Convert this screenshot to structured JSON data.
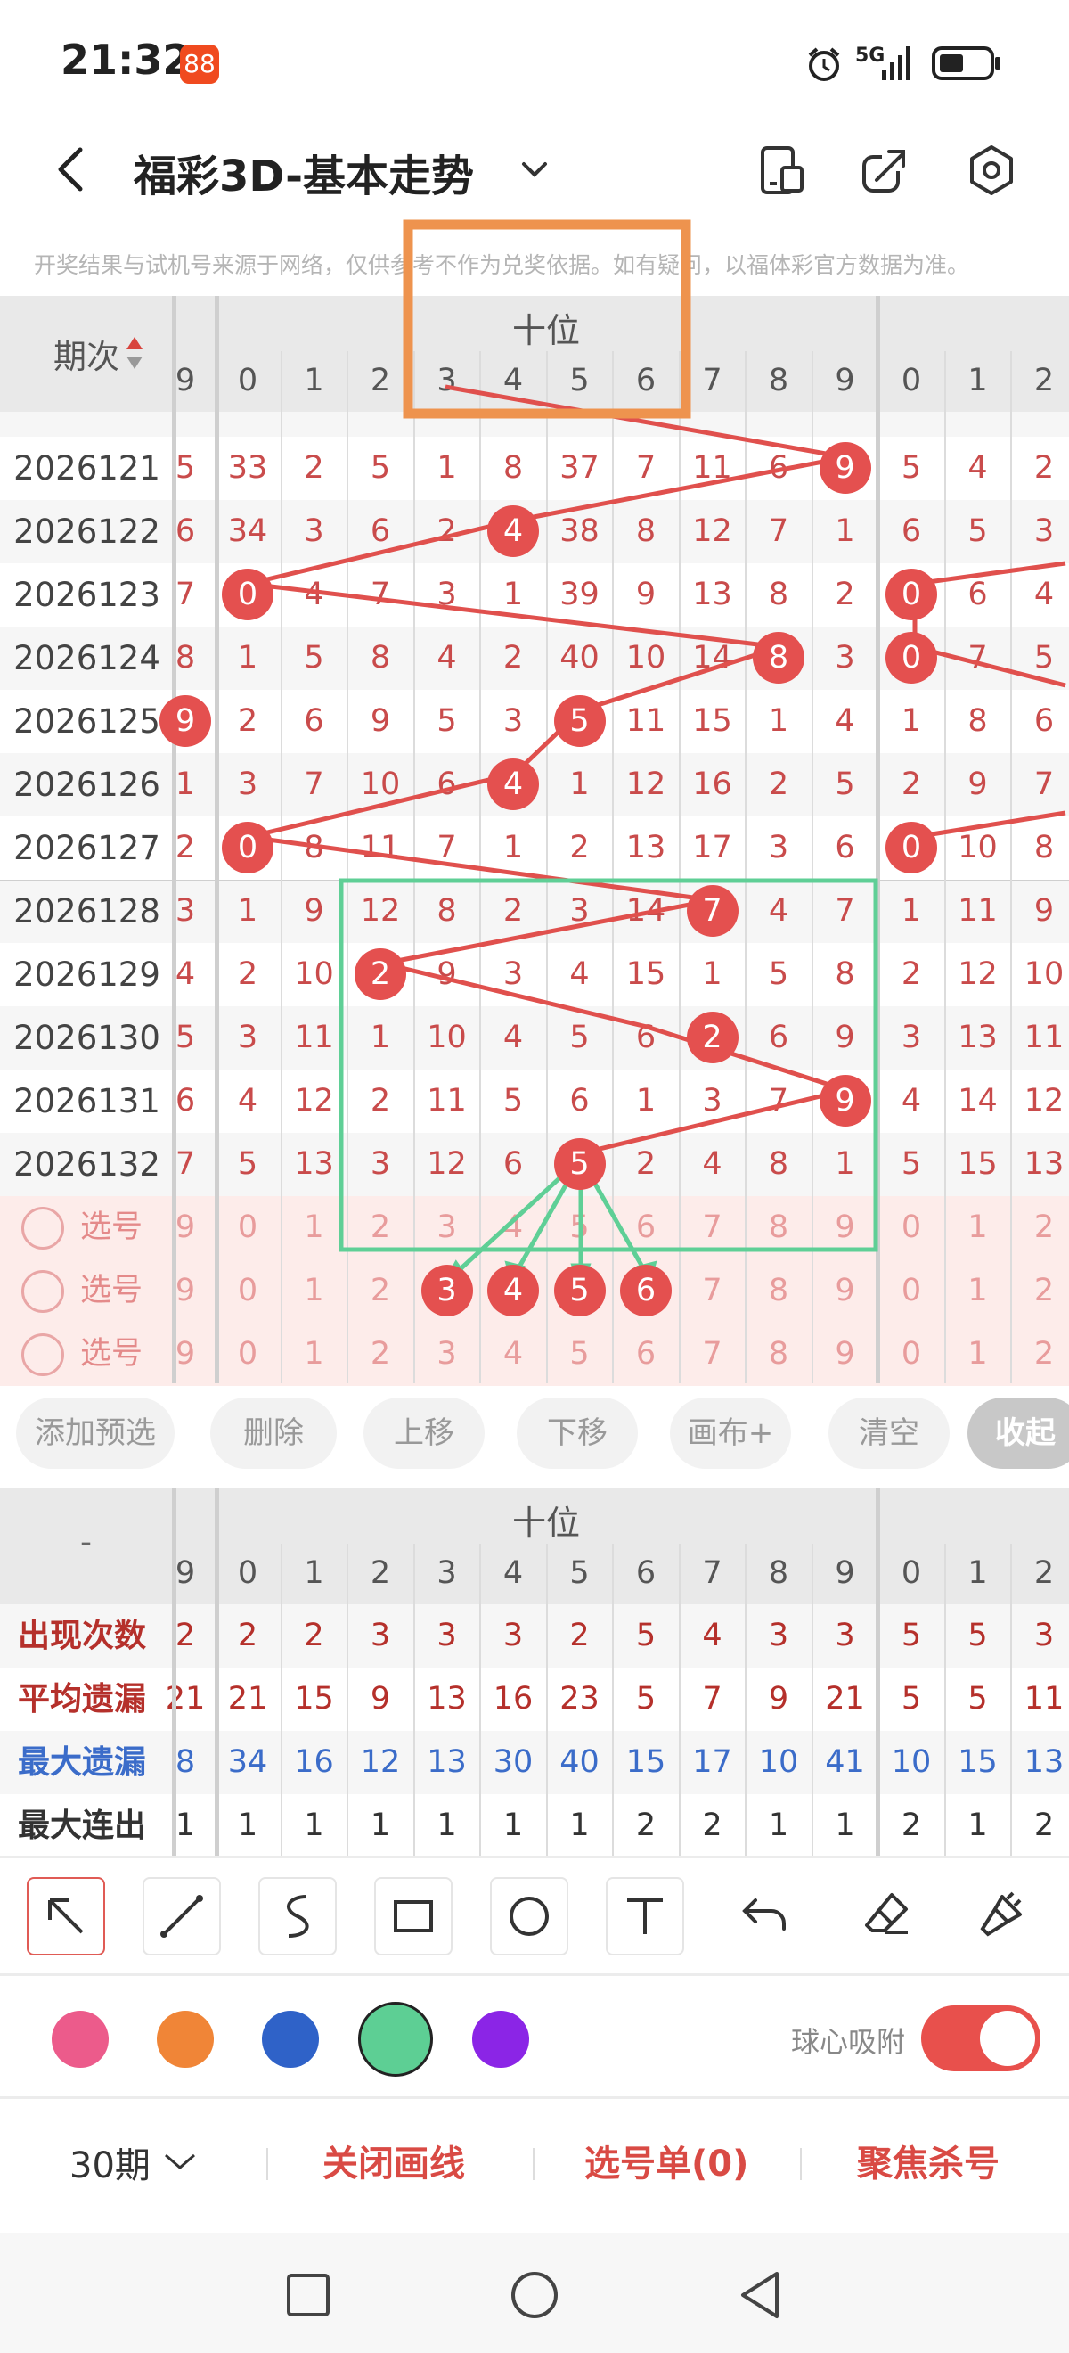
{
  "status_bar": {
    "time": "21:32",
    "app_badge": "88",
    "network": "5G",
    "icons": [
      "alarm-icon",
      "signal-icon",
      "battery-icon"
    ]
  },
  "header": {
    "title": "福彩3D-基本走势",
    "icons": [
      "back-icon",
      "chevron-down-icon",
      "phone-layout-icon",
      "share-icon",
      "settings-icon"
    ]
  },
  "notice": "开奖结果与试机号来源于网络，仅供参考不作为兑奖依据。如有疑问，以福体彩官方数据为准。",
  "table": {
    "issue_header": "期次",
    "group_header": "十位",
    "columns": [
      "9",
      "0",
      "1",
      "2",
      "3",
      "4",
      "5",
      "6",
      "7",
      "8",
      "9",
      "0",
      "1",
      "2"
    ],
    "rows": [
      {
        "issue": "2026121",
        "cells": [
          "5",
          "33",
          "2",
          "5",
          "1",
          "8",
          "37",
          "7",
          "11",
          "6",
          "9",
          "5",
          "4",
          "2"
        ]
      },
      {
        "issue": "2026122",
        "cells": [
          "6",
          "34",
          "3",
          "6",
          "2",
          "4",
          "38",
          "8",
          "12",
          "7",
          "1",
          "6",
          "5",
          "3"
        ]
      },
      {
        "issue": "2026123",
        "cells": [
          "7",
          "0",
          "4",
          "7",
          "3",
          "1",
          "39",
          "9",
          "13",
          "8",
          "2",
          "0",
          "6",
          "4"
        ]
      },
      {
        "issue": "2026124",
        "cells": [
          "8",
          "1",
          "5",
          "8",
          "4",
          "2",
          "40",
          "10",
          "14",
          "8",
          "3",
          "0",
          "7",
          "5"
        ]
      },
      {
        "issue": "2026125",
        "cells": [
          "9",
          "2",
          "6",
          "9",
          "5",
          "3",
          "5",
          "11",
          "15",
          "1",
          "4",
          "1",
          "8",
          "6"
        ]
      },
      {
        "issue": "2026126",
        "cells": [
          "1",
          "3",
          "7",
          "10",
          "6",
          "4",
          "1",
          "12",
          "16",
          "2",
          "5",
          "2",
          "9",
          "7"
        ]
      },
      {
        "issue": "2026127",
        "cells": [
          "2",
          "0",
          "8",
          "11",
          "7",
          "1",
          "2",
          "13",
          "17",
          "3",
          "6",
          "0",
          "10",
          "8"
        ]
      },
      {
        "issue": "2026128",
        "cells": [
          "3",
          "1",
          "9",
          "12",
          "8",
          "2",
          "3",
          "14",
          "7",
          "4",
          "7",
          "1",
          "11",
          "9"
        ]
      },
      {
        "issue": "2026129",
        "cells": [
          "4",
          "2",
          "10",
          "2",
          "9",
          "3",
          "4",
          "15",
          "1",
          "5",
          "8",
          "2",
          "12",
          "10"
        ]
      },
      {
        "issue": "2026130",
        "cells": [
          "5",
          "3",
          "11",
          "1",
          "10",
          "4",
          "5",
          "6",
          "2",
          "6",
          "9",
          "3",
          "13",
          "11"
        ]
      },
      {
        "issue": "2026131",
        "cells": [
          "6",
          "4",
          "12",
          "2",
          "11",
          "5",
          "6",
          "1",
          "3",
          "7",
          "9",
          "4",
          "14",
          "12"
        ]
      },
      {
        "issue": "2026132",
        "cells": [
          "7",
          "5",
          "13",
          "3",
          "12",
          "6",
          "5",
          "2",
          "4",
          "8",
          "1",
          "5",
          "15",
          "13"
        ]
      }
    ],
    "pick_rows": [
      {
        "label": "选号",
        "cells": [
          "9",
          "0",
          "1",
          "2",
          "3",
          "4",
          "5",
          "6",
          "7",
          "8",
          "9",
          "0",
          "1",
          "2"
        ]
      },
      {
        "label": "选号",
        "cells": [
          "9",
          "0",
          "1",
          "2",
          "3",
          "4",
          "5",
          "6",
          "7",
          "8",
          "9",
          "0",
          "1",
          "2"
        ]
      },
      {
        "label": "选号",
        "cells": [
          "9",
          "0",
          "1",
          "2",
          "3",
          "4",
          "5",
          "6",
          "7",
          "8",
          "9",
          "0",
          "1",
          "2"
        ]
      }
    ]
  },
  "actions": [
    "添加预选",
    "删除",
    "上移",
    "下移",
    "画布+",
    "清空",
    "收起"
  ],
  "stats": {
    "corner": "-",
    "group_header": "十位",
    "columns": [
      "9",
      "0",
      "1",
      "2",
      "3",
      "4",
      "5",
      "6",
      "7",
      "8",
      "9",
      "0",
      "1",
      "2"
    ],
    "rows": [
      {
        "label": "出现次数",
        "color": "#b5302b",
        "cells": [
          "2",
          "2",
          "2",
          "3",
          "3",
          "3",
          "2",
          "5",
          "4",
          "3",
          "3",
          "5",
          "5",
          "3"
        ]
      },
      {
        "label": "平均遗漏",
        "color": "#b5302b",
        "cells": [
          "21",
          "21",
          "15",
          "9",
          "13",
          "16",
          "23",
          "5",
          "7",
          "9",
          "21",
          "5",
          "5",
          "11"
        ]
      },
      {
        "label": "最大遗漏",
        "color": "#3b6cc9",
        "cells": [
          "8",
          "34",
          "16",
          "12",
          "13",
          "30",
          "40",
          "15",
          "17",
          "10",
          "41",
          "10",
          "15",
          "13"
        ]
      },
      {
        "label": "最大连出",
        "color": "#333333",
        "cells": [
          "1",
          "1",
          "1",
          "1",
          "1",
          "1",
          "1",
          "2",
          "2",
          "1",
          "1",
          "2",
          "1",
          "2"
        ]
      }
    ]
  },
  "draw_tools": [
    "arrow-tool-icon",
    "line-tool-icon",
    "curve-tool-icon",
    "rectangle-tool-icon",
    "circle-tool-icon",
    "text-tool-icon",
    "undo-icon",
    "eraser-icon",
    "brush-icon"
  ],
  "colors": [
    "#ec5b8b",
    "#f08537",
    "#2f62c8",
    "#5dcf94",
    "#8b25e6"
  ],
  "snap_label": "球心吸附",
  "snap_on": true,
  "bottom": {
    "period": "30期",
    "close_lines": "关闭画线",
    "selection": "选号单(0)",
    "focus": "聚焦杀号"
  },
  "nav_icons": [
    "square-icon",
    "circle-icon",
    "back-triangle-icon"
  ]
}
